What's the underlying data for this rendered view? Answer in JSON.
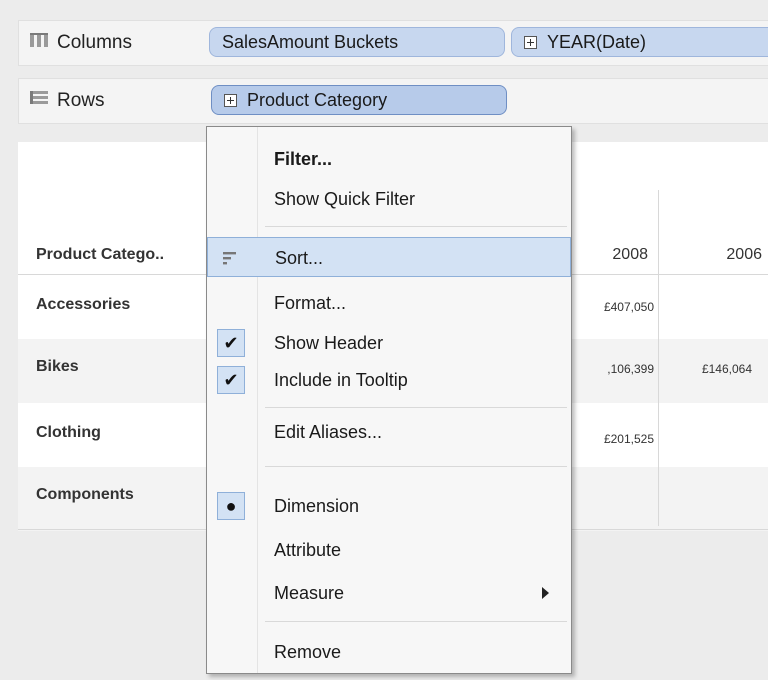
{
  "shelves": {
    "columns": {
      "label": "Columns",
      "pills": [
        "SalesAmount Buckets",
        "YEAR(Date)"
      ]
    },
    "rows": {
      "label": "Rows",
      "pills": [
        "Product Category"
      ]
    }
  },
  "view": {
    "row_header": "Product Catego..",
    "columns": [
      "2008",
      "2006"
    ],
    "rows": [
      {
        "label": "Accessories",
        "c2008": "£407,050",
        "c2006": ""
      },
      {
        "label": "Bikes",
        "c2008": ",106,399",
        "c2006": "£146,064"
      },
      {
        "label": "Clothing",
        "c2008": "£201,525",
        "c2006": ""
      },
      {
        "label": "Components",
        "c2008": "",
        "c2006": ""
      }
    ]
  },
  "context_menu": {
    "filter": "Filter...",
    "show_quick_filter": "Show Quick Filter",
    "sort": "Sort...",
    "format": "Format...",
    "show_header": "Show Header",
    "include_in_tooltip": "Include in Tooltip",
    "edit_aliases": "Edit Aliases...",
    "dimension": "Dimension",
    "attribute": "Attribute",
    "measure": "Measure",
    "remove": "Remove"
  },
  "colors": {
    "pill_fill": "#c7d7ef",
    "pill_border": "#9fb6dc",
    "highlight": "#d3e2f4"
  }
}
